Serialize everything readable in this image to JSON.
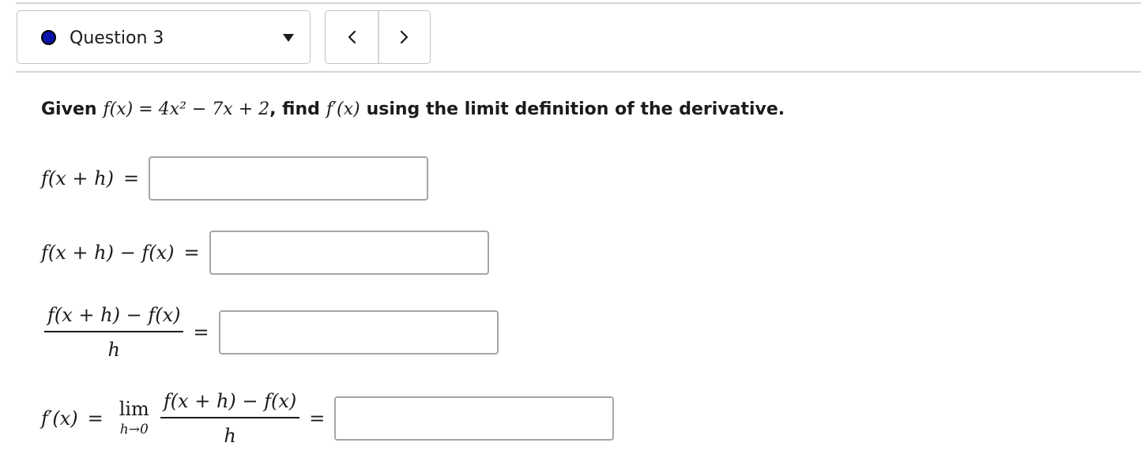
{
  "header": {
    "question_label": "Question 3",
    "status_color": "#0a14a8",
    "dropdown_icon": "caret-down-icon",
    "prev_icon": "chevron-left-icon",
    "next_icon": "chevron-right-icon"
  },
  "prompt": {
    "given": "Given",
    "find": ", find",
    "rest": "using the limit definition of the derivative.",
    "function_expr": "f(x) = 4x² − 7x + 2",
    "derivative_expr": "f′(x)"
  },
  "rows": [
    {
      "lhs": "f(x + h)",
      "eq": "=",
      "value": ""
    },
    {
      "lhs": "f(x + h) − f(x)",
      "eq": "=",
      "value": ""
    },
    {
      "numerator": "f(x + h) − f(x)",
      "denominator": "h",
      "eq": "=",
      "value": ""
    },
    {
      "lhs": "f′(x)",
      "eq": "=",
      "lim": "lim",
      "lim_sub": "h→0",
      "numerator": "f(x + h) − f(x)",
      "denominator": "h",
      "eq2": "=",
      "value": ""
    }
  ]
}
